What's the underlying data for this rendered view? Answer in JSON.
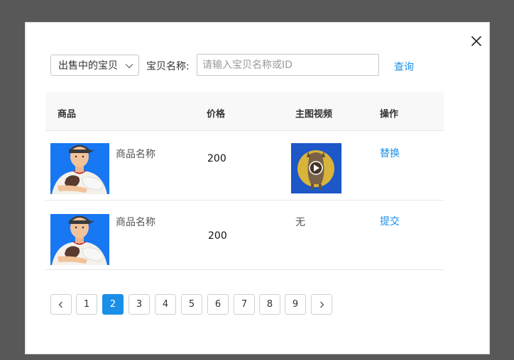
{
  "filter": {
    "status_value": "出售中的宝贝",
    "name_label": "宝贝名称:",
    "search_placeholder": "请输入宝贝名称或ID",
    "query_label": "查询"
  },
  "table": {
    "headers": {
      "product": "商品",
      "price": "价格",
      "video": "主图视频",
      "action": "操作"
    },
    "rows": [
      {
        "name": "商品名称",
        "price": "200",
        "video": "",
        "action": "替换"
      },
      {
        "name": "商品名称",
        "price": "200",
        "video": "无",
        "action": "提交"
      }
    ]
  },
  "pagination": {
    "pages": [
      "1",
      "2",
      "3",
      "4",
      "5",
      "6",
      "7",
      "8",
      "9"
    ],
    "current": "2"
  },
  "colors": {
    "accent": "#1a8fe8",
    "overlay": "#585858",
    "thumb_bg": "#1877f2"
  },
  "icons": {
    "close": "close-icon",
    "select_arrow": "chevron-down-icon",
    "prev": "chevron-left-icon",
    "next": "chevron-right-icon",
    "play": "play-icon"
  }
}
